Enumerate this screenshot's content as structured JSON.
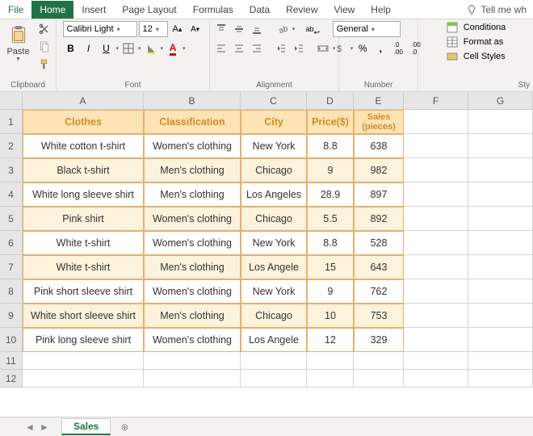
{
  "tabs": {
    "file": "File",
    "home": "Home",
    "insert": "Insert",
    "page_layout": "Page Layout",
    "formulas": "Formulas",
    "data": "Data",
    "review": "Review",
    "view": "View",
    "help": "Help",
    "tellme": "Tell me wh"
  },
  "ribbon": {
    "clipboard": {
      "label": "Clipboard",
      "paste": "Paste"
    },
    "font": {
      "label": "Font",
      "family": "Calibri Light",
      "size": "12",
      "bold": "B",
      "italic": "I",
      "underline": "U"
    },
    "alignment": {
      "label": "Alignment",
      "wrap": "ab"
    },
    "number": {
      "label": "Number",
      "format": "General",
      "pct": "%",
      "comma": ","
    },
    "styles": {
      "label": "Sty",
      "conditional": "Conditiona",
      "format_as": "Format as",
      "cell_styles": "Cell Styles"
    }
  },
  "columns": [
    "A",
    "B",
    "C",
    "D",
    "E",
    "F",
    "G"
  ],
  "row_numbers": [
    "1",
    "2",
    "3",
    "4",
    "5",
    "6",
    "7",
    "8",
    "9",
    "10",
    "11",
    "12"
  ],
  "table": {
    "headers": [
      "Clothes",
      "Classification",
      "City",
      "Price($)",
      "Sales (pieces)"
    ],
    "rows": [
      [
        "White cotton t-shirt",
        "Women's clothing",
        "New York",
        "8.8",
        "638"
      ],
      [
        "Black t-shirt",
        "Men's clothing",
        "Chicago",
        "9",
        "982"
      ],
      [
        "White long sleeve shirt",
        "Men's clothing",
        "Los Angeles",
        "28.9",
        "897"
      ],
      [
        "Pink shirt",
        "Women's clothing",
        "Chicago",
        "5.5",
        "892"
      ],
      [
        "White t-shirt",
        "Women's clothing",
        "New York",
        "8.8",
        "528"
      ],
      [
        "White t-shirt",
        "Men's clothing",
        "Los Angele",
        "15",
        "643"
      ],
      [
        "Pink short sleeve shirt",
        "Women's clothing",
        "New York",
        "9",
        "762"
      ],
      [
        "White short sleeve shirt",
        "Men's clothing",
        "Chicago",
        "10",
        "753"
      ],
      [
        "Pink long sleeve shirt",
        "Women's clothing",
        "Los Angele",
        "12",
        "329"
      ]
    ]
  },
  "sheet_tab": "Sales",
  "chart_data": {
    "type": "table",
    "title": "Sales",
    "columns": [
      "Clothes",
      "Classification",
      "City",
      "Price($)",
      "Sales (pieces)"
    ],
    "rows": [
      {
        "Clothes": "White cotton t-shirt",
        "Classification": "Women's clothing",
        "City": "New York",
        "Price($)": 8.8,
        "Sales (pieces)": 638
      },
      {
        "Clothes": "Black t-shirt",
        "Classification": "Men's clothing",
        "City": "Chicago",
        "Price($)": 9,
        "Sales (pieces)": 982
      },
      {
        "Clothes": "White long sleeve shirt",
        "Classification": "Men's clothing",
        "City": "Los Angeles",
        "Price($)": 28.9,
        "Sales (pieces)": 897
      },
      {
        "Clothes": "Pink shirt",
        "Classification": "Women's clothing",
        "City": "Chicago",
        "Price($)": 5.5,
        "Sales (pieces)": 892
      },
      {
        "Clothes": "White t-shirt",
        "Classification": "Women's clothing",
        "City": "New York",
        "Price($)": 8.8,
        "Sales (pieces)": 528
      },
      {
        "Clothes": "White t-shirt",
        "Classification": "Men's clothing",
        "City": "Los Angele",
        "Price($)": 15,
        "Sales (pieces)": 643
      },
      {
        "Clothes": "Pink short sleeve shirt",
        "Classification": "Women's clothing",
        "City": "New York",
        "Price($)": 9,
        "Sales (pieces)": 762
      },
      {
        "Clothes": "White short sleeve shirt",
        "Classification": "Men's clothing",
        "City": "Chicago",
        "Price($)": 10,
        "Sales (pieces)": 753
      },
      {
        "Clothes": "Pink long sleeve shirt",
        "Classification": "Women's clothing",
        "City": "Los Angele",
        "Price($)": 12,
        "Sales (pieces)": 329
      }
    ]
  }
}
